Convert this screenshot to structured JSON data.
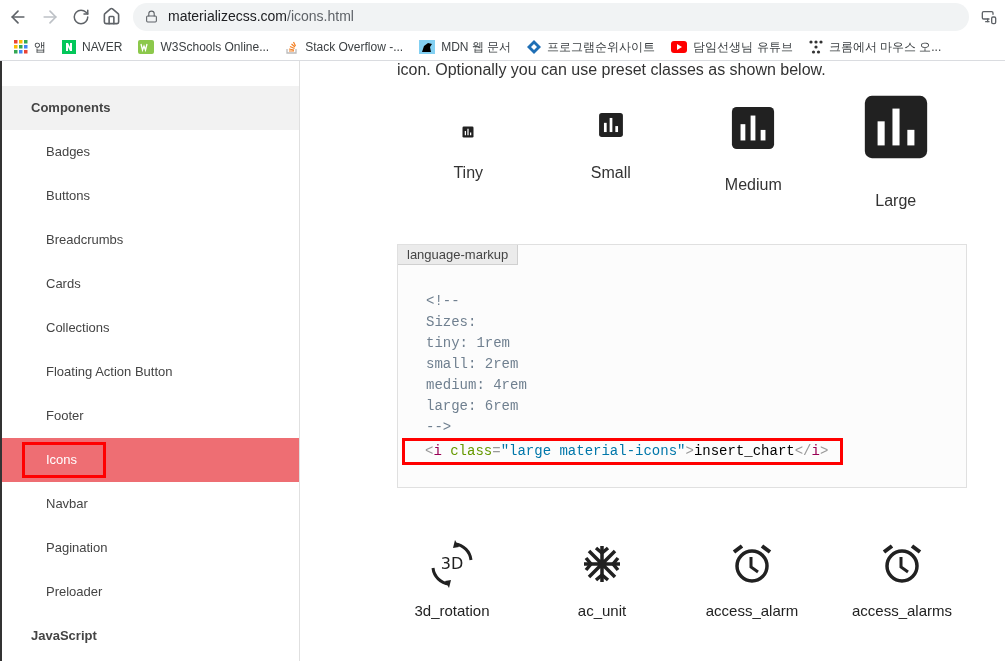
{
  "browser": {
    "url_host": "materializecss.com",
    "url_path": "/icons.html",
    "bookmarks": [
      {
        "label": "앱",
        "kind": "apps"
      },
      {
        "label": "NAVER",
        "kind": "naver"
      },
      {
        "label": "W3Schools Online...",
        "kind": "w3"
      },
      {
        "label": "Stack Overflow -...",
        "kind": "stack"
      },
      {
        "label": "MDN 웹 문서",
        "kind": "mdn"
      },
      {
        "label": "프로그램순위사이트",
        "kind": "diamond"
      },
      {
        "label": "담임선생님 유튜브",
        "kind": "youtube"
      },
      {
        "label": "크롬에서 마우스 오...",
        "kind": "dots"
      }
    ]
  },
  "sidebar": {
    "items": [
      {
        "label": "Components",
        "kind": "section",
        "selected": false,
        "annotated": false
      },
      {
        "label": "Badges",
        "kind": "link",
        "selected": false,
        "annotated": false
      },
      {
        "label": "Buttons",
        "kind": "link",
        "selected": false,
        "annotated": false
      },
      {
        "label": "Breadcrumbs",
        "kind": "link",
        "selected": false,
        "annotated": false
      },
      {
        "label": "Cards",
        "kind": "link",
        "selected": false,
        "annotated": false
      },
      {
        "label": "Collections",
        "kind": "link",
        "selected": false,
        "annotated": false
      },
      {
        "label": "Floating Action Button",
        "kind": "link",
        "selected": false,
        "annotated": false
      },
      {
        "label": "Footer",
        "kind": "link",
        "selected": false,
        "annotated": false
      },
      {
        "label": "Icons",
        "kind": "link",
        "selected": true,
        "annotated": true
      },
      {
        "label": "Navbar",
        "kind": "link",
        "selected": false,
        "annotated": false
      },
      {
        "label": "Pagination",
        "kind": "link",
        "selected": false,
        "annotated": false
      },
      {
        "label": "Preloader",
        "kind": "link",
        "selected": false,
        "annotated": false
      },
      {
        "label": "JavaScript",
        "kind": "top",
        "selected": false,
        "annotated": false
      }
    ]
  },
  "intro": "icon. Optionally you can use preset classes as shown below.",
  "sizes": [
    {
      "label": "Tiny",
      "kind": "tiny"
    },
    {
      "label": "Small",
      "kind": "small"
    },
    {
      "label": "Medium",
      "kind": "medium"
    },
    {
      "label": "Large",
      "kind": "large"
    }
  ],
  "code": {
    "language": "language-markup",
    "lines": [
      {
        "annotated": false,
        "tokens": [
          {
            "kind": "comment",
            "text": "<!--"
          }
        ]
      },
      {
        "annotated": false,
        "tokens": [
          {
            "kind": "comment",
            "text": "Sizes:"
          }
        ]
      },
      {
        "annotated": false,
        "tokens": [
          {
            "kind": "comment",
            "text": "tiny: 1rem"
          }
        ]
      },
      {
        "annotated": false,
        "tokens": [
          {
            "kind": "comment",
            "text": "small: 2rem"
          }
        ]
      },
      {
        "annotated": false,
        "tokens": [
          {
            "kind": "comment",
            "text": "medium: 4rem"
          }
        ]
      },
      {
        "annotated": false,
        "tokens": [
          {
            "kind": "comment",
            "text": "large: 6rem"
          }
        ]
      },
      {
        "annotated": false,
        "tokens": [
          {
            "kind": "comment",
            "text": "-->"
          }
        ]
      },
      {
        "annotated": true,
        "tokens": [
          {
            "kind": "punct",
            "text": "<"
          },
          {
            "kind": "tag",
            "text": "i"
          },
          {
            "kind": "attr",
            "text": " class"
          },
          {
            "kind": "punct",
            "text": "="
          },
          {
            "kind": "value",
            "text": "\"large material-icons\""
          },
          {
            "kind": "punct",
            "text": ">"
          },
          {
            "kind": "plain",
            "text": "insert_chart"
          },
          {
            "kind": "punct",
            "text": "</"
          },
          {
            "kind": "tag",
            "text": "i"
          },
          {
            "kind": "punct",
            "text": ">"
          }
        ]
      }
    ]
  },
  "icons": [
    {
      "label": "3d_rotation",
      "kind": "rotation",
      "glyph": "3D"
    },
    {
      "label": "ac_unit",
      "kind": "snowflake"
    },
    {
      "label": "access_alarm",
      "kind": "alarm"
    },
    {
      "label": "access_alarms",
      "kind": "alarm"
    }
  ]
}
